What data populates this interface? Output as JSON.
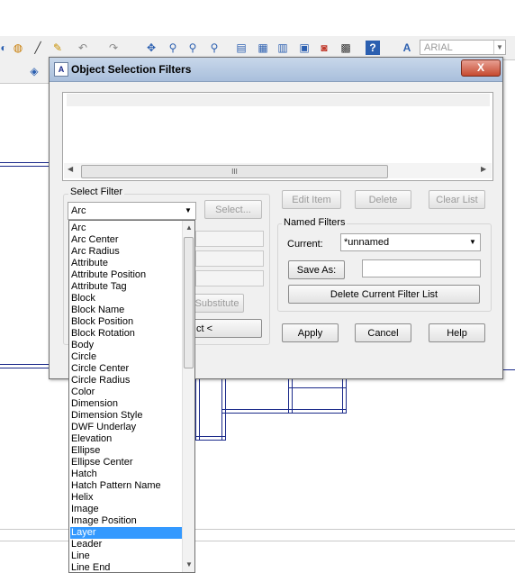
{
  "toolbar": {
    "font_name": "ARIAL",
    "icons": [
      "open-icon",
      "pencil-icon",
      "brush-icon",
      "undo-icon",
      "redo-icon",
      "pan-icon",
      "zoom-realtime-icon",
      "zoom-window-icon",
      "zoom-previous-icon",
      "properties-icon",
      "design-center-icon",
      "tool-palettes-icon",
      "sheet-set-icon",
      "markup-icon",
      "calculator-icon",
      "help-icon",
      "text-style-icon"
    ]
  },
  "dialog": {
    "title": "Object Selection Filters",
    "close_label": "X",
    "list_scroll_grip": "III",
    "select_filter": {
      "group_label": "Select Filter",
      "selected": "Arc",
      "select_button": "Select...",
      "substitute_button": "Substitute",
      "add_button_partial": "ct <"
    },
    "edit_item_button": "Edit Item",
    "delete_button": "Delete",
    "clear_list_button": "Clear List",
    "named_filters": {
      "group_label": "Named Filters",
      "current_label": "Current:",
      "current_value": "*unnamed",
      "save_as_button": "Save As:",
      "save_as_value": "",
      "delete_filter_button": "Delete Current Filter List"
    },
    "apply_button": "Apply",
    "cancel_button": "Cancel",
    "help_button": "Help"
  },
  "filter_options": {
    "selected_index": 26,
    "items": [
      "Arc",
      "Arc Center",
      "Arc Radius",
      "Attribute",
      "Attribute Position",
      "Attribute Tag",
      "Block",
      "Block Name",
      "Block Position",
      "Block Rotation",
      "Body",
      "Circle",
      "Circle Center",
      "Circle Radius",
      "Color",
      "Dimension",
      "Dimension Style",
      "DWF Underlay",
      "Elevation",
      "Ellipse",
      "Ellipse Center",
      "Hatch",
      "Hatch Pattern Name",
      "Helix",
      "Image",
      "Image Position",
      "Layer",
      "Leader",
      "Line",
      "Line End"
    ]
  }
}
